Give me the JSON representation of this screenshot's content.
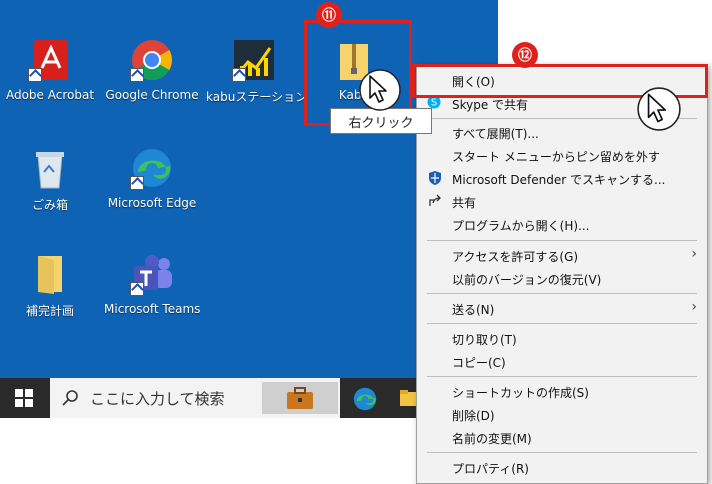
{
  "desktop": {
    "icons": [
      {
        "label": "Adobe Acrobat",
        "icon": "adobe-acrobat-icon"
      },
      {
        "label": "Google Chrome",
        "icon": "chrome-icon"
      },
      {
        "label": "kabuステーション",
        "icon": "kabu-station-icon"
      },
      {
        "label": "Kabu",
        "icon": "zip-folder-icon"
      },
      {
        "label": "ごみ箱",
        "icon": "recycle-bin-icon"
      },
      {
        "label": "Microsoft Edge",
        "icon": "edge-icon"
      },
      {
        "label": "補完計画",
        "icon": "folder-icon"
      },
      {
        "label": "Microsoft Teams",
        "icon": "teams-icon"
      }
    ]
  },
  "taskbar": {
    "search_placeholder": "ここに入力して検索"
  },
  "annotations": {
    "step11": "⑪",
    "step12": "⑫",
    "right_click_label": "右クリック"
  },
  "context_menu": {
    "items": [
      {
        "label": "開く(O)"
      },
      {
        "label": "Skype で共有"
      },
      {
        "label": "すべて展開(T)..."
      },
      {
        "label": "スタート メニューからピン留めを外す"
      },
      {
        "label": "Microsoft Defender でスキャンする..."
      },
      {
        "label": "共有"
      },
      {
        "label": "プログラムから開く(H)..."
      },
      {
        "label": "アクセスを許可する(G)"
      },
      {
        "label": "以前のバージョンの復元(V)"
      },
      {
        "label": "送る(N)"
      },
      {
        "label": "切り取り(T)"
      },
      {
        "label": "コピー(C)"
      },
      {
        "label": "ショートカットの作成(S)"
      },
      {
        "label": "削除(D)"
      },
      {
        "label": "名前の変更(M)"
      },
      {
        "label": "プロパティ(R)"
      }
    ]
  },
  "colors": {
    "desktop_bg": "#0f63b4",
    "accent_red": "#e0211b",
    "menu_bg": "#f2f2f2"
  }
}
